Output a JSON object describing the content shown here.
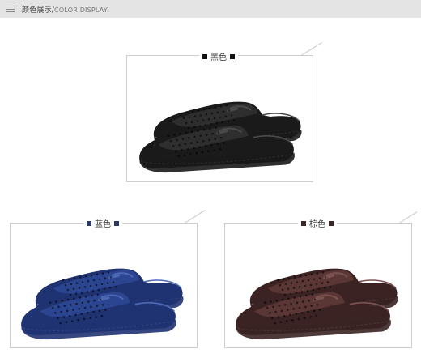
{
  "header": {
    "title_cn": "颜色展示/",
    "title_en": "COLOR DISPLAY",
    "menu_icon": "menu-icon"
  },
  "colors": [
    {
      "label": "黑色",
      "swatch": "#111111",
      "shoe_main": "#1a1a1a",
      "shoe_mid": "#2e2e2e",
      "shoe_light": "#4a4a4a"
    },
    {
      "label": "蓝色",
      "swatch": "#2a3a6a",
      "shoe_main": "#1f3272",
      "shoe_mid": "#2c4590",
      "shoe_light": "#4d68b4"
    },
    {
      "label": "棕色",
      "swatch": "#3b2624",
      "shoe_main": "#3a2322",
      "shoe_mid": "#5a3634",
      "shoe_light": "#7a5250"
    }
  ],
  "accent_colors": {
    "header_bg": "#e4e4e4",
    "frame": "#cfcfcf"
  }
}
